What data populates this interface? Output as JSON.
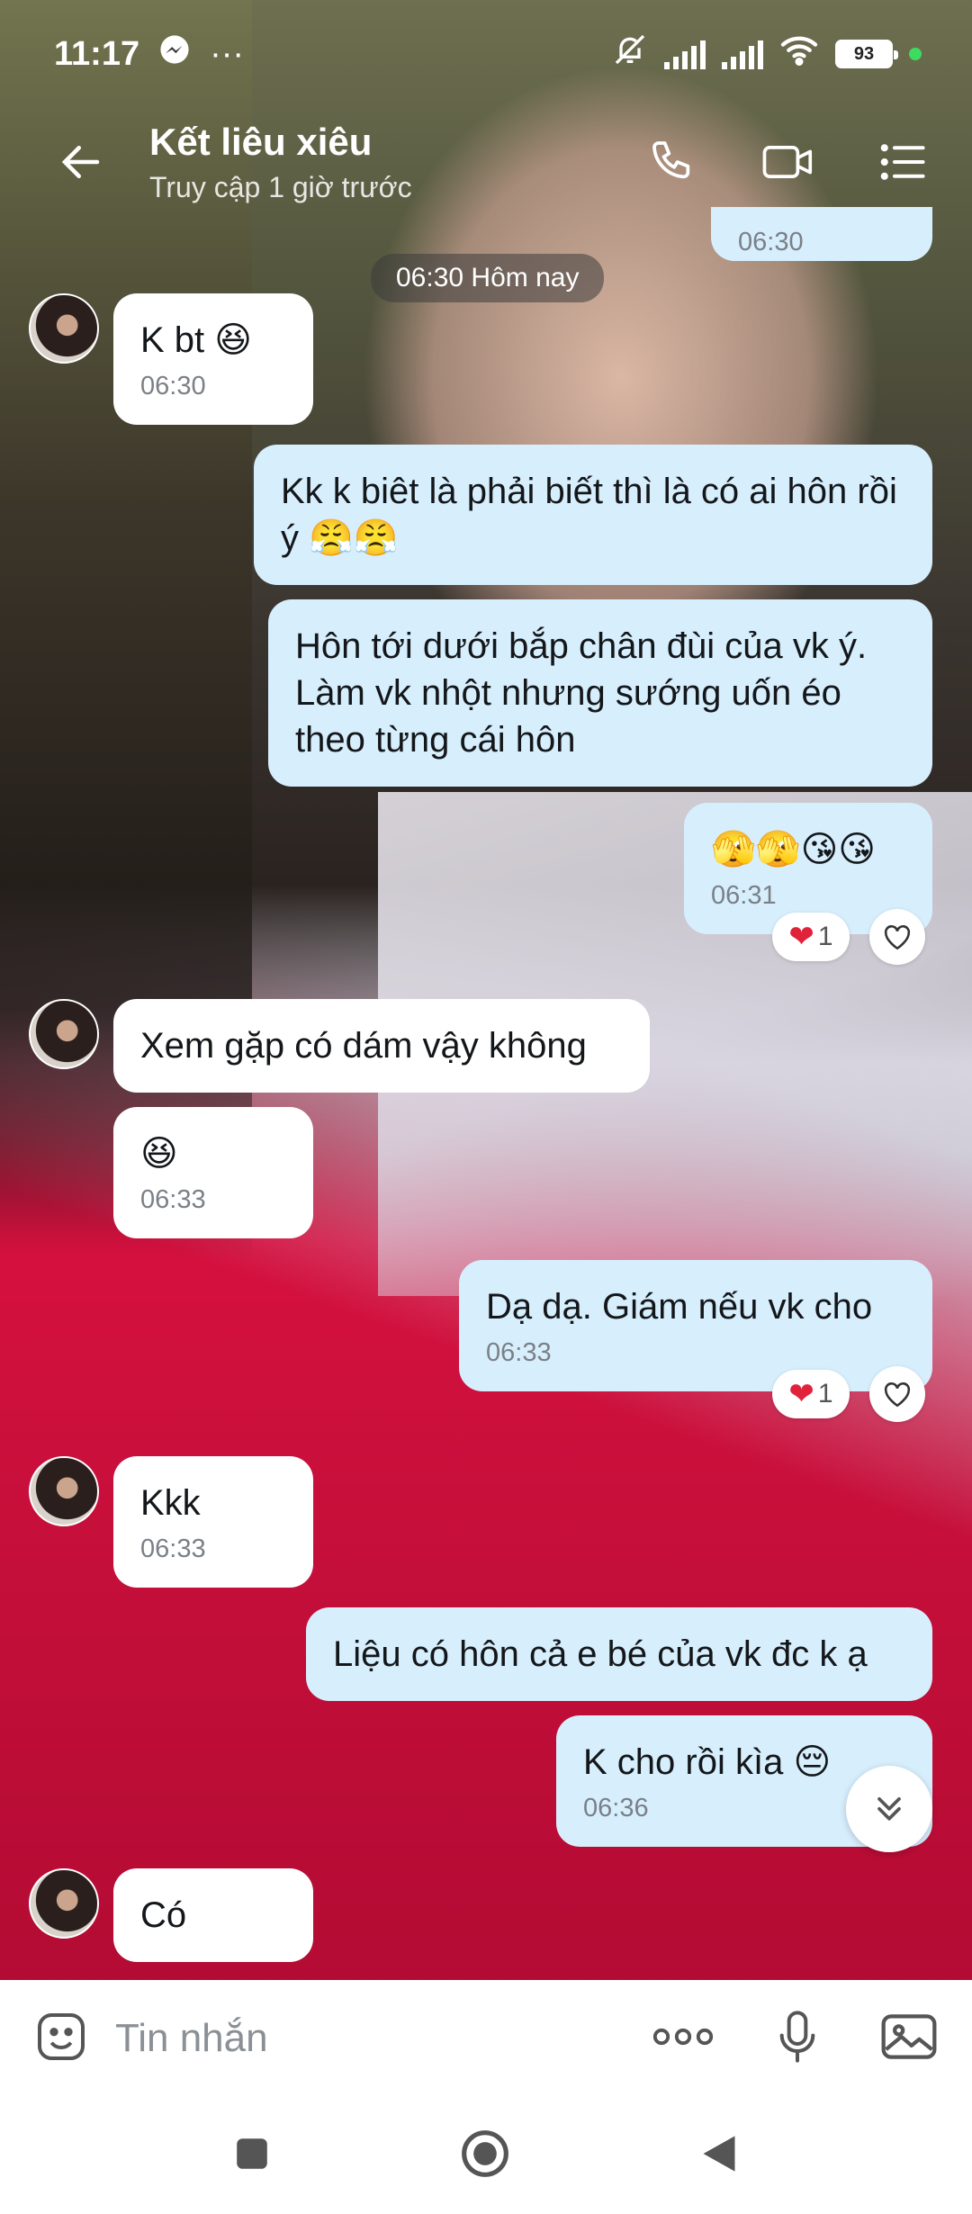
{
  "status_bar": {
    "time": "11:17",
    "dots": "···",
    "battery": "93"
  },
  "header": {
    "contact_name": "Kết liêu xiêu",
    "last_seen": "Truy cập 1 giờ trước"
  },
  "chat": {
    "date_pill": "06:30 Hôm nay",
    "messages": [
      {
        "dir": "out",
        "text": "",
        "time": "06:30"
      },
      {
        "dir": "in",
        "text": "K bt 😆",
        "time": "06:30"
      },
      {
        "dir": "out",
        "text": "Kk k biêt là phải biết thì là có ai hôn rồi ý 😤😤",
        "time": ""
      },
      {
        "dir": "out",
        "text": "Hôn tới dưới bắp chân đùi của vk ý. Làm vk nhột nhưng sướng uốn éo theo từng cái hôn",
        "time": ""
      },
      {
        "dir": "out",
        "text": "🫣🫣😘😘",
        "time": "06:31",
        "reaction_count": "1"
      },
      {
        "dir": "in",
        "text": "Xem gặp có dám vậy không",
        "time": ""
      },
      {
        "dir": "in",
        "text": "😆",
        "time": "06:33"
      },
      {
        "dir": "out",
        "text": "Dạ dạ. Giám nếu vk cho",
        "time": "06:33",
        "reaction_count": "1"
      },
      {
        "dir": "in",
        "text": "Kkk",
        "time": "06:33"
      },
      {
        "dir": "out",
        "text": "Liệu có hôn cả e bé của vk đc k ạ",
        "time": ""
      },
      {
        "dir": "out",
        "text": "K cho rồi kìa 😔",
        "time": "06:36"
      },
      {
        "dir": "in",
        "text": "Có",
        "time": ""
      }
    ]
  },
  "composer": {
    "placeholder": "Tin nhắn"
  },
  "colors": {
    "incoming_bubble": "#ffffff",
    "outgoing_bubble": "#d7eefd",
    "heart": "#e0233a"
  }
}
